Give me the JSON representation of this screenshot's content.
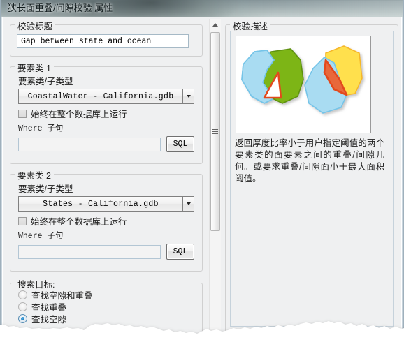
{
  "window": {
    "title": "狭长面重叠/间隙校验 属性"
  },
  "validation_title_group": {
    "caption": "校验标题",
    "value": "Gap between state and ocean",
    "placeholder": ""
  },
  "feature_class_1": {
    "caption": "要素类 1",
    "subtype_label": "要素类/子类型",
    "combo_value": "CoastalWater  -  California.gdb",
    "checkbox_label": "始终在整个数据库上运行",
    "checkbox_checked": false,
    "where_label": "Where 子句",
    "where_value": "",
    "sql_button": "SQL"
  },
  "feature_class_2": {
    "caption": "要素类 2",
    "subtype_label": "要素类/子类型",
    "combo_value": "States -  California.gdb",
    "checkbox_label": "始终在整个数据库上运行",
    "checkbox_checked": false,
    "where_label": "Where 子句",
    "where_value": "",
    "sql_button": "SQL"
  },
  "search_target": {
    "caption": "搜索目标:",
    "options": [
      {
        "label": "查找空隙和重叠",
        "selected": false
      },
      {
        "label": "查找重叠",
        "selected": false
      },
      {
        "label": "查找空隙",
        "selected": true
      }
    ]
  },
  "description": {
    "caption": "校验描述",
    "text": "返回厚度比率小于用户指定阈值的两个要素类的面要素之间的重叠/间隙几何。或要求重叠/间隙面小于最大面积阈值。",
    "illustration": {
      "alt": "gap-and-overlap-diagram",
      "colors": {
        "blue_fill": "#a9dcf2",
        "blue_stroke": "#74c4e8",
        "green_fill": "#7db518",
        "green_stroke": "#5e9211",
        "yellow_fill": "#ffe04d",
        "yellow_stroke": "#f5b72a",
        "red_stroke": "#e3491f",
        "red_fill": "#e8673a"
      }
    }
  },
  "scrollbar": {
    "up_arrow": "scroll-up",
    "down_arrow": "scroll-down"
  }
}
